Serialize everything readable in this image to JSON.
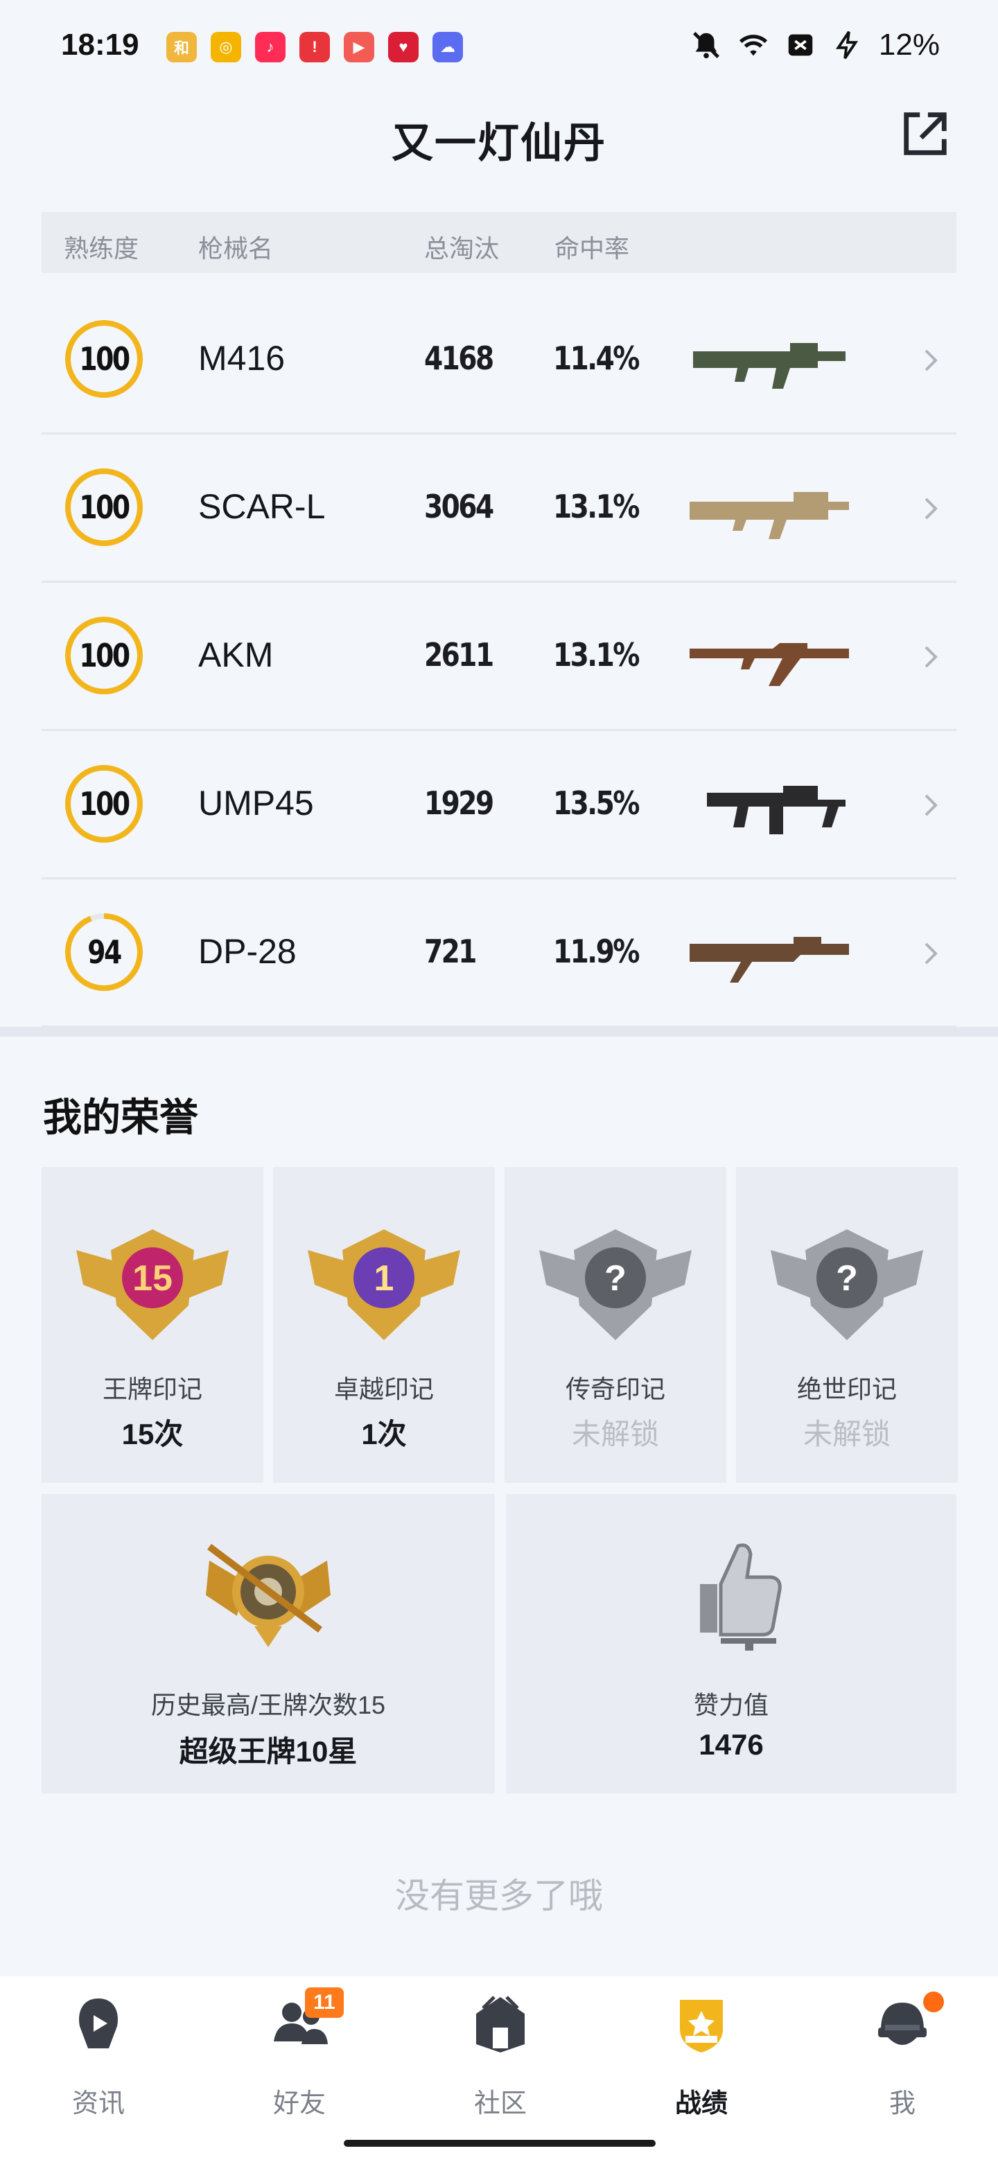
{
  "status_bar": {
    "time": "18:19",
    "battery": "12%",
    "notif_apps": [
      {
        "icon": "game-app-icon",
        "color": "#f1b63c",
        "text": "和"
      },
      {
        "icon": "music-disc-icon",
        "color": "#f4b400",
        "text": "◎"
      },
      {
        "icon": "music-note-icon",
        "color": "#ff2d55",
        "text": "♪"
      },
      {
        "icon": "alert-app-icon",
        "color": "#e8343b",
        "text": "!"
      },
      {
        "icon": "play-app-icon",
        "color": "#f25c54",
        "text": "▶"
      },
      {
        "icon": "shopping-app-icon",
        "color": "#d91e36",
        "text": "♥"
      },
      {
        "icon": "weather-app-icon",
        "color": "#5b6cf0",
        "text": "☁"
      }
    ]
  },
  "header": {
    "title": "又一灯仙丹"
  },
  "table": {
    "headers": {
      "mastery": "熟练度",
      "gun": "枪械名",
      "kills": "总淘汰",
      "hit_rate": "命中率"
    },
    "rows": [
      {
        "mastery": 100,
        "name": "M416",
        "kills": "4168",
        "hit_rate": "11.4%",
        "gun_icon": "m416-rifle-icon",
        "gun_color": "#4b5a43"
      },
      {
        "mastery": 100,
        "name": "SCAR-L",
        "kills": "3064",
        "hit_rate": "13.1%",
        "gun_icon": "scar-l-rifle-icon",
        "gun_color": "#b39b74"
      },
      {
        "mastery": 100,
        "name": "AKM",
        "kills": "2611",
        "hit_rate": "13.1%",
        "gun_icon": "akm-rifle-icon",
        "gun_color": "#7a4a2e"
      },
      {
        "mastery": 100,
        "name": "UMP45",
        "kills": "1929",
        "hit_rate": "13.5%",
        "gun_icon": "ump45-smg-icon",
        "gun_color": "#2a2a2c"
      },
      {
        "mastery": 94,
        "name": "DP-28",
        "kills": "721",
        "hit_rate": "11.9%",
        "gun_icon": "dp-28-lmg-icon",
        "gun_color": "#6a4a32"
      }
    ]
  },
  "honors": {
    "title": "我的荣誉",
    "marks": [
      {
        "label": "王牌印记",
        "value": "15次",
        "locked": false,
        "badge_icon": "ace-mark-badge-icon",
        "badge_text": "15"
      },
      {
        "label": "卓越印记",
        "value": "1次",
        "locked": false,
        "badge_icon": "excellence-mark-badge-icon",
        "badge_text": "1"
      },
      {
        "label": "传奇印记",
        "value": "未解锁",
        "locked": true,
        "badge_icon": "legend-mark-badge-icon",
        "badge_text": "?"
      },
      {
        "label": "绝世印记",
        "value": "未解锁",
        "locked": true,
        "badge_icon": "peerless-mark-badge-icon",
        "badge_text": "?"
      }
    ],
    "best_rank": {
      "label": "历史最高/王牌次数15",
      "value": "超级王牌10星"
    },
    "likes": {
      "label": "赞力值",
      "value": "1476"
    }
  },
  "footer_text": "没有更多了哦",
  "tabs": [
    {
      "label": "资讯",
      "icon": "news-icon",
      "active": false,
      "badge": ""
    },
    {
      "label": "好友",
      "icon": "friends-icon",
      "active": false,
      "badge": "11"
    },
    {
      "label": "社区",
      "icon": "community-icon",
      "active": false,
      "badge": ""
    },
    {
      "label": "战绩",
      "icon": "record-icon",
      "active": true,
      "badge": ""
    },
    {
      "label": "我",
      "icon": "profile-icon",
      "active": false,
      "badge": ""
    }
  ],
  "colors": {
    "accent": "#f2b51b",
    "ring_track": "#e6e8ec",
    "badge_orange": "#ff7a1a"
  }
}
